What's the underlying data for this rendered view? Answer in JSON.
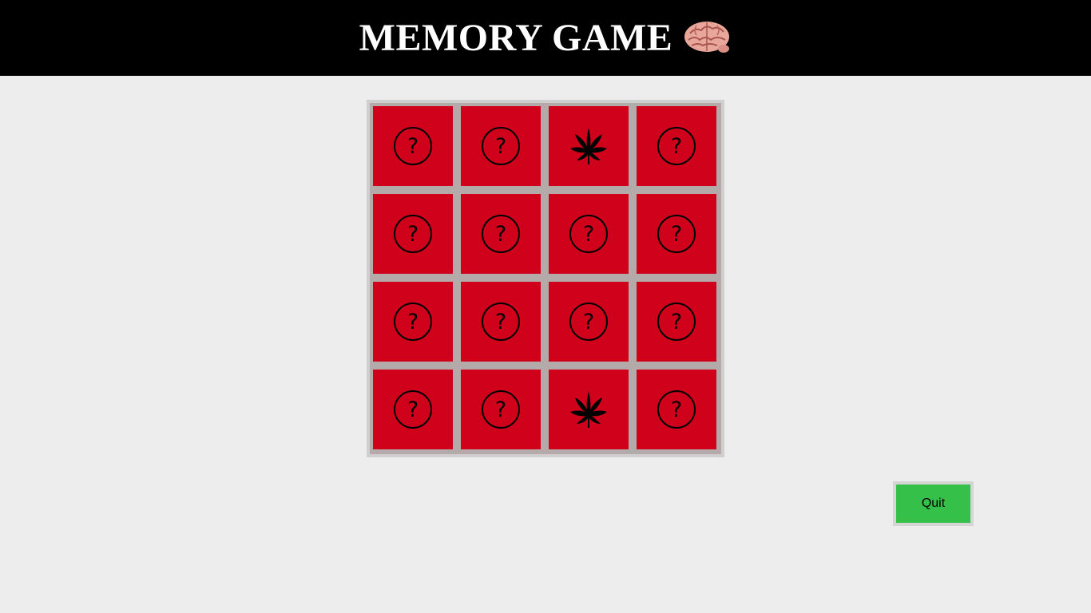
{
  "header": {
    "title": "MEMORY GAME",
    "logo_icon": "brain-icon"
  },
  "colors": {
    "header_bg": "#000000",
    "page_bg": "#ededed",
    "card_face_down": "#d0021b",
    "board_bg": "#b5aaaa",
    "quit_button": "#35c04a"
  },
  "board": {
    "rows": 4,
    "cols": 4,
    "cards": [
      {
        "state": "hidden",
        "face": "?",
        "icon": "question-circle-icon"
      },
      {
        "state": "hidden",
        "face": "?",
        "icon": "question-circle-icon"
      },
      {
        "state": "revealed",
        "icon": "cannabis-leaf-icon"
      },
      {
        "state": "hidden",
        "face": "?",
        "icon": "question-circle-icon"
      },
      {
        "state": "hidden",
        "face": "?",
        "icon": "question-circle-icon"
      },
      {
        "state": "hidden",
        "face": "?",
        "icon": "question-circle-icon"
      },
      {
        "state": "hidden",
        "face": "?",
        "icon": "question-circle-icon"
      },
      {
        "state": "hidden",
        "face": "?",
        "icon": "question-circle-icon"
      },
      {
        "state": "hidden",
        "face": "?",
        "icon": "question-circle-icon"
      },
      {
        "state": "hidden",
        "face": "?",
        "icon": "question-circle-icon"
      },
      {
        "state": "hidden",
        "face": "?",
        "icon": "question-circle-icon"
      },
      {
        "state": "hidden",
        "face": "?",
        "icon": "question-circle-icon"
      },
      {
        "state": "hidden",
        "face": "?",
        "icon": "question-circle-icon"
      },
      {
        "state": "hidden",
        "face": "?",
        "icon": "question-circle-icon"
      },
      {
        "state": "revealed",
        "icon": "cannabis-leaf-icon"
      },
      {
        "state": "hidden",
        "face": "?",
        "icon": "question-circle-icon"
      }
    ]
  },
  "controls": {
    "quit_label": "Quit"
  }
}
